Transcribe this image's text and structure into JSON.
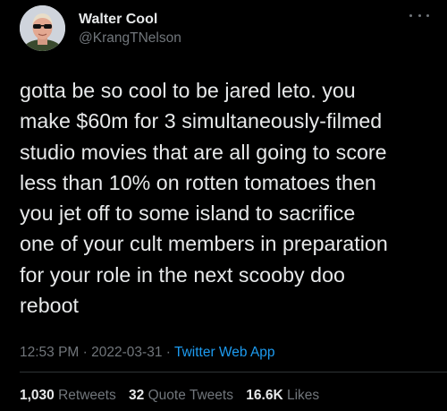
{
  "author": {
    "display_name": "Walter Cool",
    "handle": "@KrangTNelson"
  },
  "tweet": {
    "text": "gotta be so cool to be jared leto. you\nmake $60m for 3 simultaneously-filmed\nstudio movies that are all going to score\nless than 10% on rotten tomatoes then\nyou jet off to some island to sacrifice\none of your cult members in preparation\nfor your role in the next scooby doo\nreboot"
  },
  "meta": {
    "time": "12:53 PM",
    "separator": "·",
    "date": "2022-03-31",
    "source": "Twitter Web App"
  },
  "stats": {
    "retweets_count": "1,030",
    "retweets_label": "Retweets",
    "quotes_count": "32",
    "quotes_label": "Quote Tweets",
    "likes_count": "16.6K",
    "likes_label": "Likes"
  },
  "colors": {
    "background": "#000000",
    "text_primary": "#e7e9ea",
    "text_secondary": "#71767b",
    "link": "#1d9bf0",
    "divider": "#2f3336"
  },
  "icons": {
    "more": "more-horizontal-icon"
  }
}
